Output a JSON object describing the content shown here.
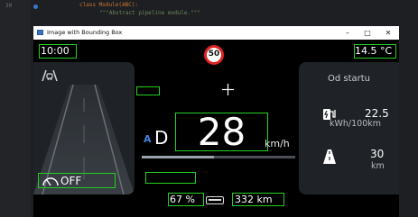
{
  "editor": {
    "line_numbers": [
      "30"
    ],
    "code_line_1": "class Module(ABC):",
    "code_line_2": "\"\"\"Abstract pipeline module.\"\"\""
  },
  "window": {
    "title": "Image with Bounding Box",
    "minimize_label": "–",
    "maximize_label": "□",
    "close_label": "✕"
  },
  "hud": {
    "clock": "10:00",
    "temperature": "14.5 °C",
    "speed_limit": "50",
    "gear_mode": "A",
    "gear": "D",
    "speed": "28",
    "speed_unit": "km/h",
    "assist_status": "OFF",
    "battery_percent": "67 %",
    "range": "332 km",
    "speed_bar_fraction": 0.47
  },
  "trip": {
    "heading": "Od startu",
    "consumption_value": "22.5",
    "consumption_unit": "kWh/100km",
    "distance_value": "30",
    "distance_unit": "km"
  },
  "colors": {
    "bounding_box": "#21d11f",
    "gear_mode_accent": "#3e86d8",
    "limit_ring": "#dd2222"
  }
}
